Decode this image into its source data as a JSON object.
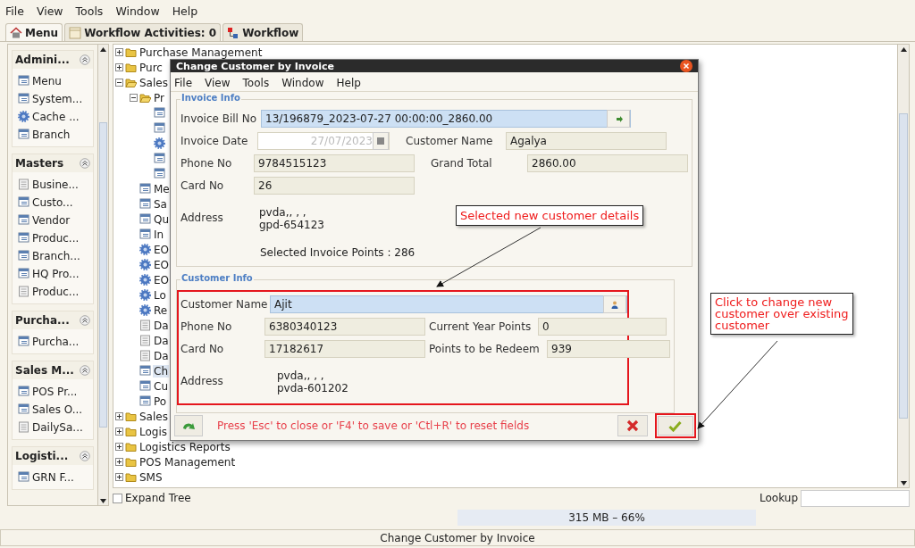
{
  "menu_bar": [
    "File",
    "View",
    "Tools",
    "Window",
    "Help"
  ],
  "tabs": [
    {
      "label": "Menu",
      "kind": "home",
      "selected": true
    },
    {
      "label": "Workflow Activities: 0",
      "kind": "list",
      "selected": false
    },
    {
      "label": "Workflow",
      "kind": "flow",
      "selected": false
    }
  ],
  "sidebar": {
    "sections": [
      {
        "title": "Admini...",
        "items": [
          {
            "label": "Menu",
            "kind": "form"
          },
          {
            "label": "System...",
            "kind": "form"
          },
          {
            "label": "Cache ...",
            "kind": "gear"
          },
          {
            "label": "Branch",
            "kind": "form"
          }
        ]
      },
      {
        "title": "Masters",
        "items": [
          {
            "label": "Busine...",
            "kind": "report"
          },
          {
            "label": "Custo...",
            "kind": "form"
          },
          {
            "label": "Vendor",
            "kind": "form"
          },
          {
            "label": "Produc...",
            "kind": "form"
          },
          {
            "label": "Branch...",
            "kind": "form"
          },
          {
            "label": "HQ Pro...",
            "kind": "form"
          },
          {
            "label": "Produc...",
            "kind": "report"
          }
        ]
      },
      {
        "title": "Purcha...",
        "items": [
          {
            "label": "Purcha...",
            "kind": "form"
          }
        ]
      },
      {
        "title": "Sales M...",
        "items": [
          {
            "label": "POS Pr...",
            "kind": "form"
          },
          {
            "label": "Sales O...",
            "kind": "form"
          },
          {
            "label": "DailySa...",
            "kind": "report"
          }
        ]
      },
      {
        "title": "Logisti...",
        "items": [
          {
            "label": "GRN F...",
            "kind": "form"
          }
        ]
      }
    ]
  },
  "tree": [
    {
      "label": "Purchase Management",
      "kind": "folder",
      "expanded": false
    },
    {
      "label": "Purc",
      "kind": "folder",
      "expanded": false
    },
    {
      "label": "Sales",
      "kind": "folder",
      "expanded": true,
      "children": [
        {
          "label": "Pr",
          "kind": "folder",
          "expanded": true,
          "children": [
            {
              "kind": "form"
            },
            {
              "kind": "form"
            },
            {
              "kind": "gear"
            },
            {
              "kind": "form"
            },
            {
              "kind": "form"
            }
          ]
        },
        {
          "label": "Me",
          "kind": "form"
        },
        {
          "label": "Sa",
          "kind": "form"
        },
        {
          "label": "Qu",
          "kind": "form"
        },
        {
          "label": "In",
          "kind": "form"
        },
        {
          "label": "EO",
          "kind": "gear"
        },
        {
          "label": "EO",
          "kind": "gear"
        },
        {
          "label": "EO",
          "kind": "gear"
        },
        {
          "label": "Lo",
          "kind": "gear"
        },
        {
          "label": "Re",
          "kind": "gear"
        },
        {
          "label": "Da",
          "kind": "report"
        },
        {
          "label": "Da",
          "kind": "report"
        },
        {
          "label": "Da",
          "kind": "report"
        },
        {
          "label": "Ch",
          "kind": "form",
          "selected": true
        },
        {
          "label": "Cu",
          "kind": "form"
        },
        {
          "label": "Po",
          "kind": "form"
        }
      ]
    },
    {
      "label": "Sales",
      "kind": "folder",
      "expanded": false
    },
    {
      "label": "Logis",
      "kind": "folder",
      "expanded": false
    },
    {
      "label": "Logistics Reports",
      "kind": "folder",
      "expanded": false
    },
    {
      "label": "POS Management",
      "kind": "folder",
      "expanded": false
    },
    {
      "label": "SMS",
      "kind": "folder",
      "expanded": false
    }
  ],
  "expand_tree": {
    "label": "Expand Tree",
    "checked": false
  },
  "lookup": {
    "label": "Lookup"
  },
  "memory": {
    "text": "315 MB – 66%"
  },
  "status_bar": "Change Customer by Invoice",
  "dialog": {
    "title": "Change Customer by Invoice",
    "menu_bar": [
      "File",
      "View",
      "Tools",
      "Window",
      "Help"
    ],
    "invoice_info": {
      "legend": "Invoice Info",
      "rows": [
        [
          {
            "label": "Invoice Bill No",
            "value": "13/196879_2023-07-27 00:00:00_2860.00",
            "kind": "combo"
          }
        ],
        [
          {
            "label": "Invoice Date",
            "value": "27/07/2023",
            "kind": "date",
            "disabled": true
          },
          {
            "label": "Customer Name",
            "value": "Agalya",
            "kind": "readonly"
          }
        ],
        [
          {
            "label": "Phone No",
            "value": "9784515123",
            "kind": "readonly"
          },
          {
            "label": "Grand Total",
            "value": "2860.00",
            "kind": "readonly"
          }
        ],
        [
          {
            "label": "Card No",
            "value": "26",
            "kind": "readonly"
          }
        ],
        [
          {
            "label": "Address",
            "lines": [
              "pvda,, , ,",
              "gpd-654123"
            ],
            "kind": "address"
          }
        ]
      ],
      "points": "Selected Invoice Points : 286"
    },
    "customer_info": {
      "legend": "Customer Info",
      "rows": [
        [
          {
            "label": "Customer Name",
            "value": "Ajit",
            "kind": "person"
          }
        ],
        [
          {
            "label": "Phone No",
            "value": "6380340123",
            "kind": "readonly"
          },
          {
            "label": "Current Year Points",
            "value": "0",
            "kind": "readonly"
          }
        ],
        [
          {
            "label": "Card No",
            "value": "17182617",
            "kind": "readonly"
          },
          {
            "label": "Points to be Redeem",
            "value": "939",
            "kind": "readonly"
          }
        ],
        [
          {
            "label": "Address",
            "lines": [
              "pvda,, , ,",
              "pvda-601202"
            ],
            "kind": "address"
          }
        ]
      ]
    },
    "hint": "Press 'Esc' to close or 'F4' to save or 'Ctl+R' to reset fields"
  },
  "annotations": [
    {
      "text": "Selected new customer details"
    },
    {
      "text": "Click to change new customer over existing customer"
    }
  ]
}
